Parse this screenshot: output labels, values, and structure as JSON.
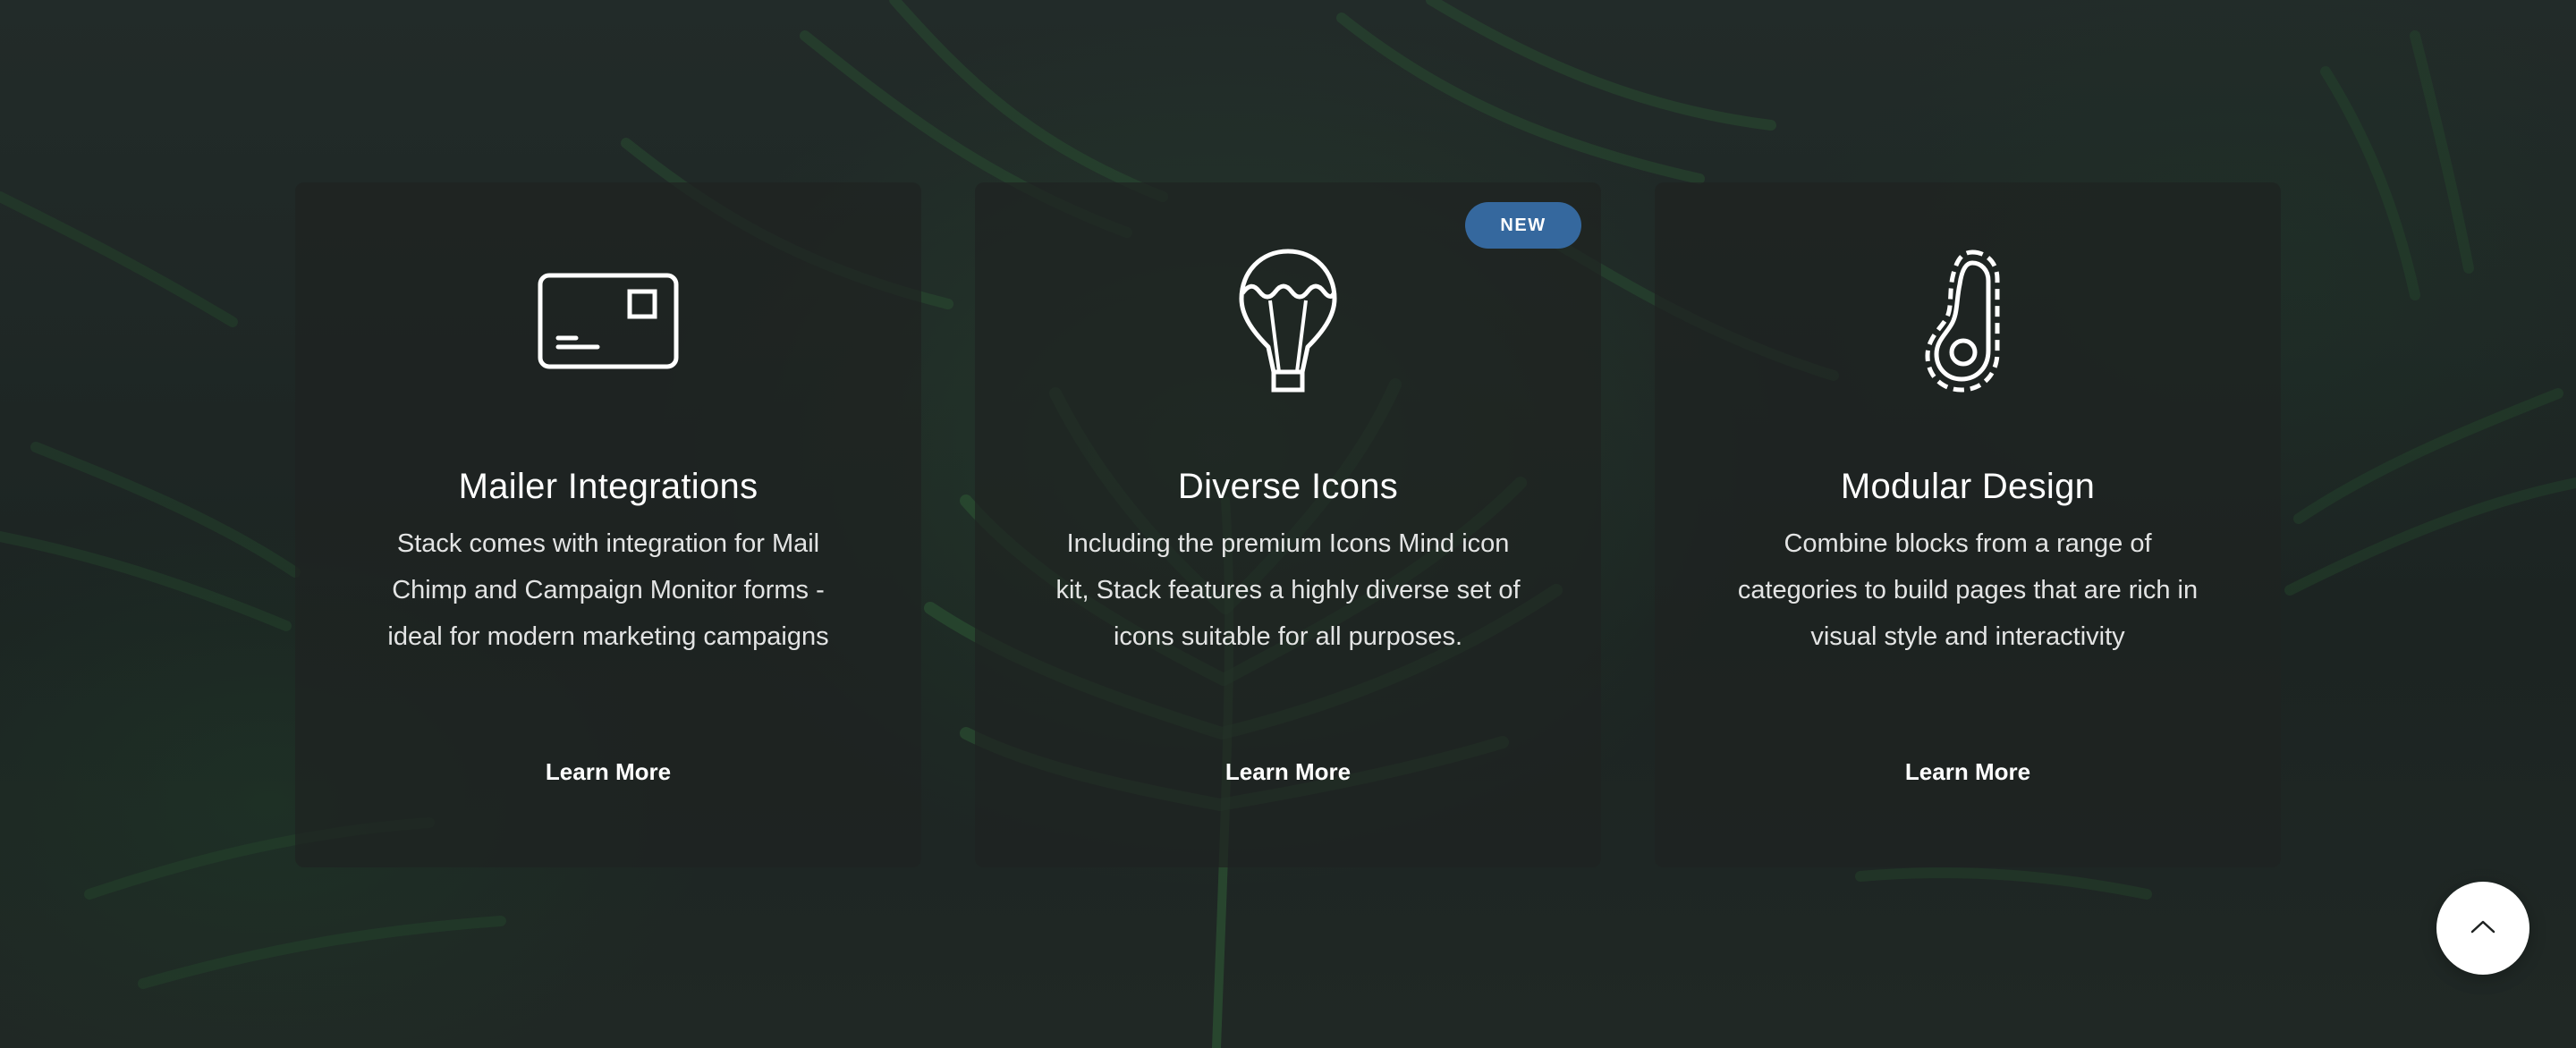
{
  "features": [
    {
      "icon": "envelope-card-icon",
      "title": "Mailer Integrations",
      "description": "Stack comes with integration for Mail Chimp and Campaign Monitor forms - ideal for modern marketing campaigns",
      "link": "Learn More"
    },
    {
      "icon": "hot-air-balloon-icon",
      "badge": "NEW",
      "title": "Diverse Icons",
      "description": "Including the premium Icons Mind icon kit, Stack features a highly diverse set of icons suitable for all purposes.",
      "link": "Learn More"
    },
    {
      "icon": "avocado-icon",
      "title": "Modular Design",
      "description": "Combine blocks from a range of categories to build pages that are rich in visual style and interactivity",
      "link": "Learn More"
    }
  ],
  "scroll_top": {
    "icon": "chevron-up-icon"
  },
  "colors": {
    "badge": "#35689e",
    "card_background": "#1e2221",
    "text": "#ffffff"
  }
}
